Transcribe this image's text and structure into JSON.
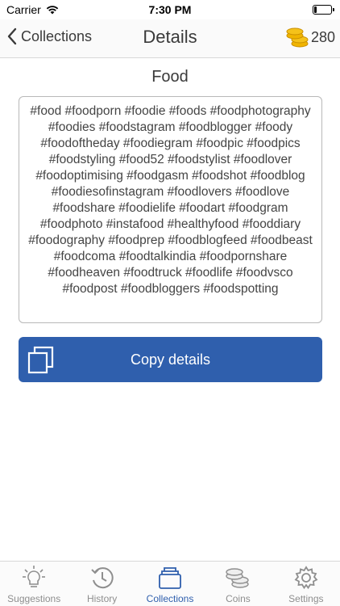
{
  "status": {
    "carrier": "Carrier",
    "time": "7:30 PM",
    "battery_level": 0.15
  },
  "nav": {
    "back_label": "Collections",
    "title": "Details",
    "coins": "280"
  },
  "collection": {
    "name": "Food",
    "details": "#food #foodporn #foodie #foods #foodphotography #foodies #foodstagram #foodblogger #foody #foodoftheday #foodiegram #foodpic #foodpics #foodstyling #food52 #foodstylist #foodlover #foodoptimising #foodgasm #foodshot #foodblog #foodiesofinstagram #foodlovers #foodlove #foodshare #foodielife #foodart #foodgram #foodphoto #instafood #healthyfood #fooddiary #foodography #foodprep #foodblogfeed #foodbeast #foodcoma #foodtalkindia #foodpornshare #foodheaven #foodtruck #foodlife #foodvsco #foodpost #foodbloggers #foodspotting"
  },
  "actions": {
    "copy_label": "Copy details"
  },
  "tabs": [
    {
      "label": "Suggestions",
      "icon": "lightbulb-icon",
      "active": false
    },
    {
      "label": "History",
      "icon": "history-icon",
      "active": false
    },
    {
      "label": "Collections",
      "icon": "collections-icon",
      "active": true
    },
    {
      "label": "Coins",
      "icon": "coins-icon",
      "active": false
    },
    {
      "label": "Settings",
      "icon": "gear-icon",
      "active": false
    }
  ],
  "colors": {
    "accent": "#2f5fad",
    "coin": "#f0b400",
    "inactive": "#8e8e8e"
  }
}
